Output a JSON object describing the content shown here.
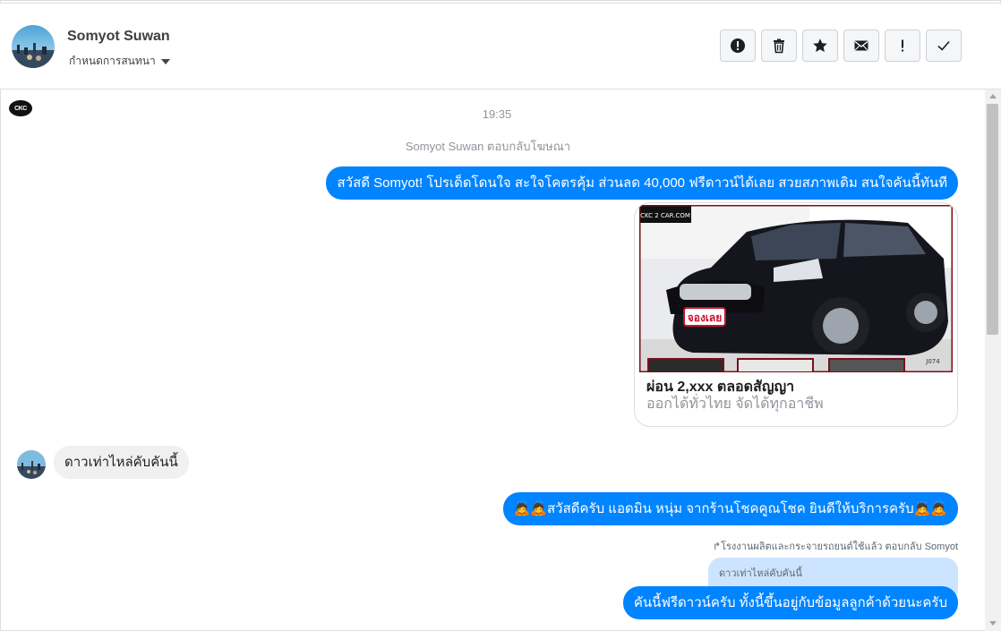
{
  "header": {
    "contact_name": "Somyot Suwan",
    "assign_label": "กำหนดการสนทนา",
    "actions": [
      {
        "name": "spam-button",
        "icon": "alert-circle-icon"
      },
      {
        "name": "delete-button",
        "icon": "trash-icon"
      },
      {
        "name": "star-button",
        "icon": "star-icon"
      },
      {
        "name": "mark-unread-button",
        "icon": "envelope-icon"
      },
      {
        "name": "follow-up-button",
        "icon": "exclamation-icon"
      },
      {
        "name": "mark-done-button",
        "icon": "checkmark-icon"
      }
    ]
  },
  "thread": {
    "page_logo_text": "CKC",
    "timestamp": "19:35",
    "ad_reply_notice": "Somyot Suwan ตอบกลับโฆษณา",
    "messages": [
      {
        "direction": "outgoing",
        "text": "สวัสดี Somyot! โปรเด็ดโดนใจ สะใจโคตรคุ้ม ส่วนลด 40,000 ฟรีดาวน์ได้เลย สวยสภาพเดิม สนใจคันนี้ทันที"
      },
      {
        "direction": "incoming",
        "text": "ดาวเท่าไหล่คับคันนี้"
      },
      {
        "direction": "outgoing",
        "text": "🙇🙇สวัสดีครับ แอดมิน หนุ่ม จากร้านโชคคูณโชค ยินดีให้บริการครับ🙇🙇"
      },
      {
        "direction": "outgoing",
        "text": "คันนี้ฟรีดาวน์ครับ ทั้งนี้ขึ้นอยู่กับข้อมูลลูกค้าด้วยนะครับ"
      }
    ],
    "ad_card": {
      "title": "ผ่อน 2,xxx ตลอดสัญญา",
      "subtitle": "ออกได้ทั่วไทย จัดได้ทุกอาชีพ",
      "image_badge": "จองเลย",
      "image_watermark": "CKC 2 CAR.COM",
      "plate": "J074"
    },
    "reply_note": "↱โรงงานผลิตและกระจายรถยนต์ใช้แล้ว ตอบกลับ Somyot",
    "quoted_text": "ดาวเท่าไหล่คับคันนี้"
  },
  "colors": {
    "accent": "#0084ff",
    "incoming_bubble": "#f1f0f0",
    "quoted_bubble": "#cce4ff",
    "meta_text": "#90949c"
  }
}
